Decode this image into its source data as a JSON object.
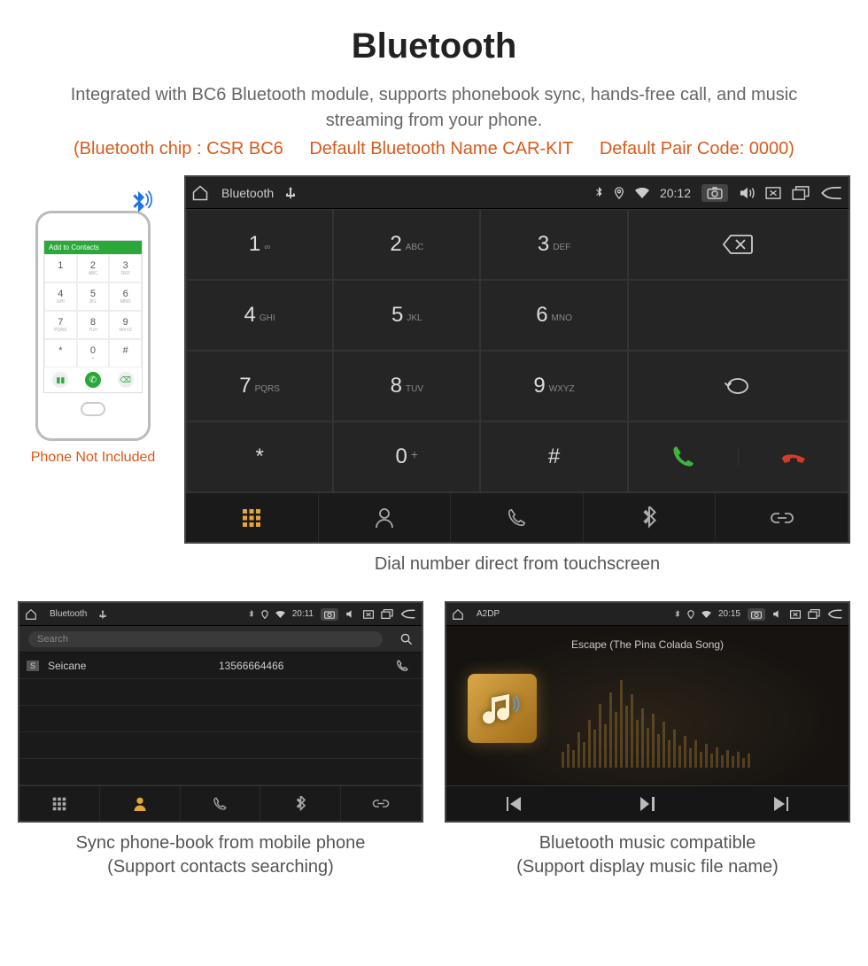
{
  "header": {
    "title": "Bluetooth",
    "subtitle": "Integrated with BC6 Bluetooth module, supports phonebook sync, hands-free call, and music streaming from your phone.",
    "spec_chip": "(Bluetooth chip : CSR BC6",
    "spec_name": "Default Bluetooth Name CAR-KIT",
    "spec_code": "Default Pair Code: 0000)"
  },
  "phone": {
    "screen_header": "Add to Contacts",
    "not_included": "Phone Not Included"
  },
  "main_device": {
    "bar_title": "Bluetooth",
    "bar_time": "20:12",
    "caption": "Dial number direct from touchscreen",
    "keys": [
      {
        "n": "1",
        "s": "∞"
      },
      {
        "n": "2",
        "s": "ABC"
      },
      {
        "n": "3",
        "s": "DEF"
      },
      {
        "n": "4",
        "s": "GHI"
      },
      {
        "n": "5",
        "s": "JKL"
      },
      {
        "n": "6",
        "s": "MNO"
      },
      {
        "n": "7",
        "s": "PQRS"
      },
      {
        "n": "8",
        "s": "TUV"
      },
      {
        "n": "9",
        "s": "WXYZ"
      },
      {
        "n": "*",
        "s": ""
      },
      {
        "n": "0",
        "s": "+"
      },
      {
        "n": "#",
        "s": ""
      }
    ]
  },
  "phonebook": {
    "bar_title": "Bluetooth",
    "bar_time": "20:11",
    "search_placeholder": "Search",
    "contact_tag": "S",
    "contact_name": "Seicane",
    "contact_number": "13566664466",
    "caption_l1": "Sync phone-book from mobile phone",
    "caption_l2": "(Support contacts searching)"
  },
  "music": {
    "bar_title": "A2DP",
    "bar_time": "20:15",
    "song": "Escape (The Pina Colada Song)",
    "caption_l1": "Bluetooth music compatible",
    "caption_l2": "(Support display music file name)"
  },
  "eq_heights": [
    20,
    30,
    22,
    45,
    32,
    60,
    48,
    80,
    55,
    95,
    70,
    110,
    78,
    92,
    60,
    75,
    50,
    68,
    42,
    58,
    35,
    48,
    28,
    40,
    24,
    34,
    20,
    30,
    18,
    26,
    16,
    22,
    14,
    20,
    12,
    18
  ]
}
